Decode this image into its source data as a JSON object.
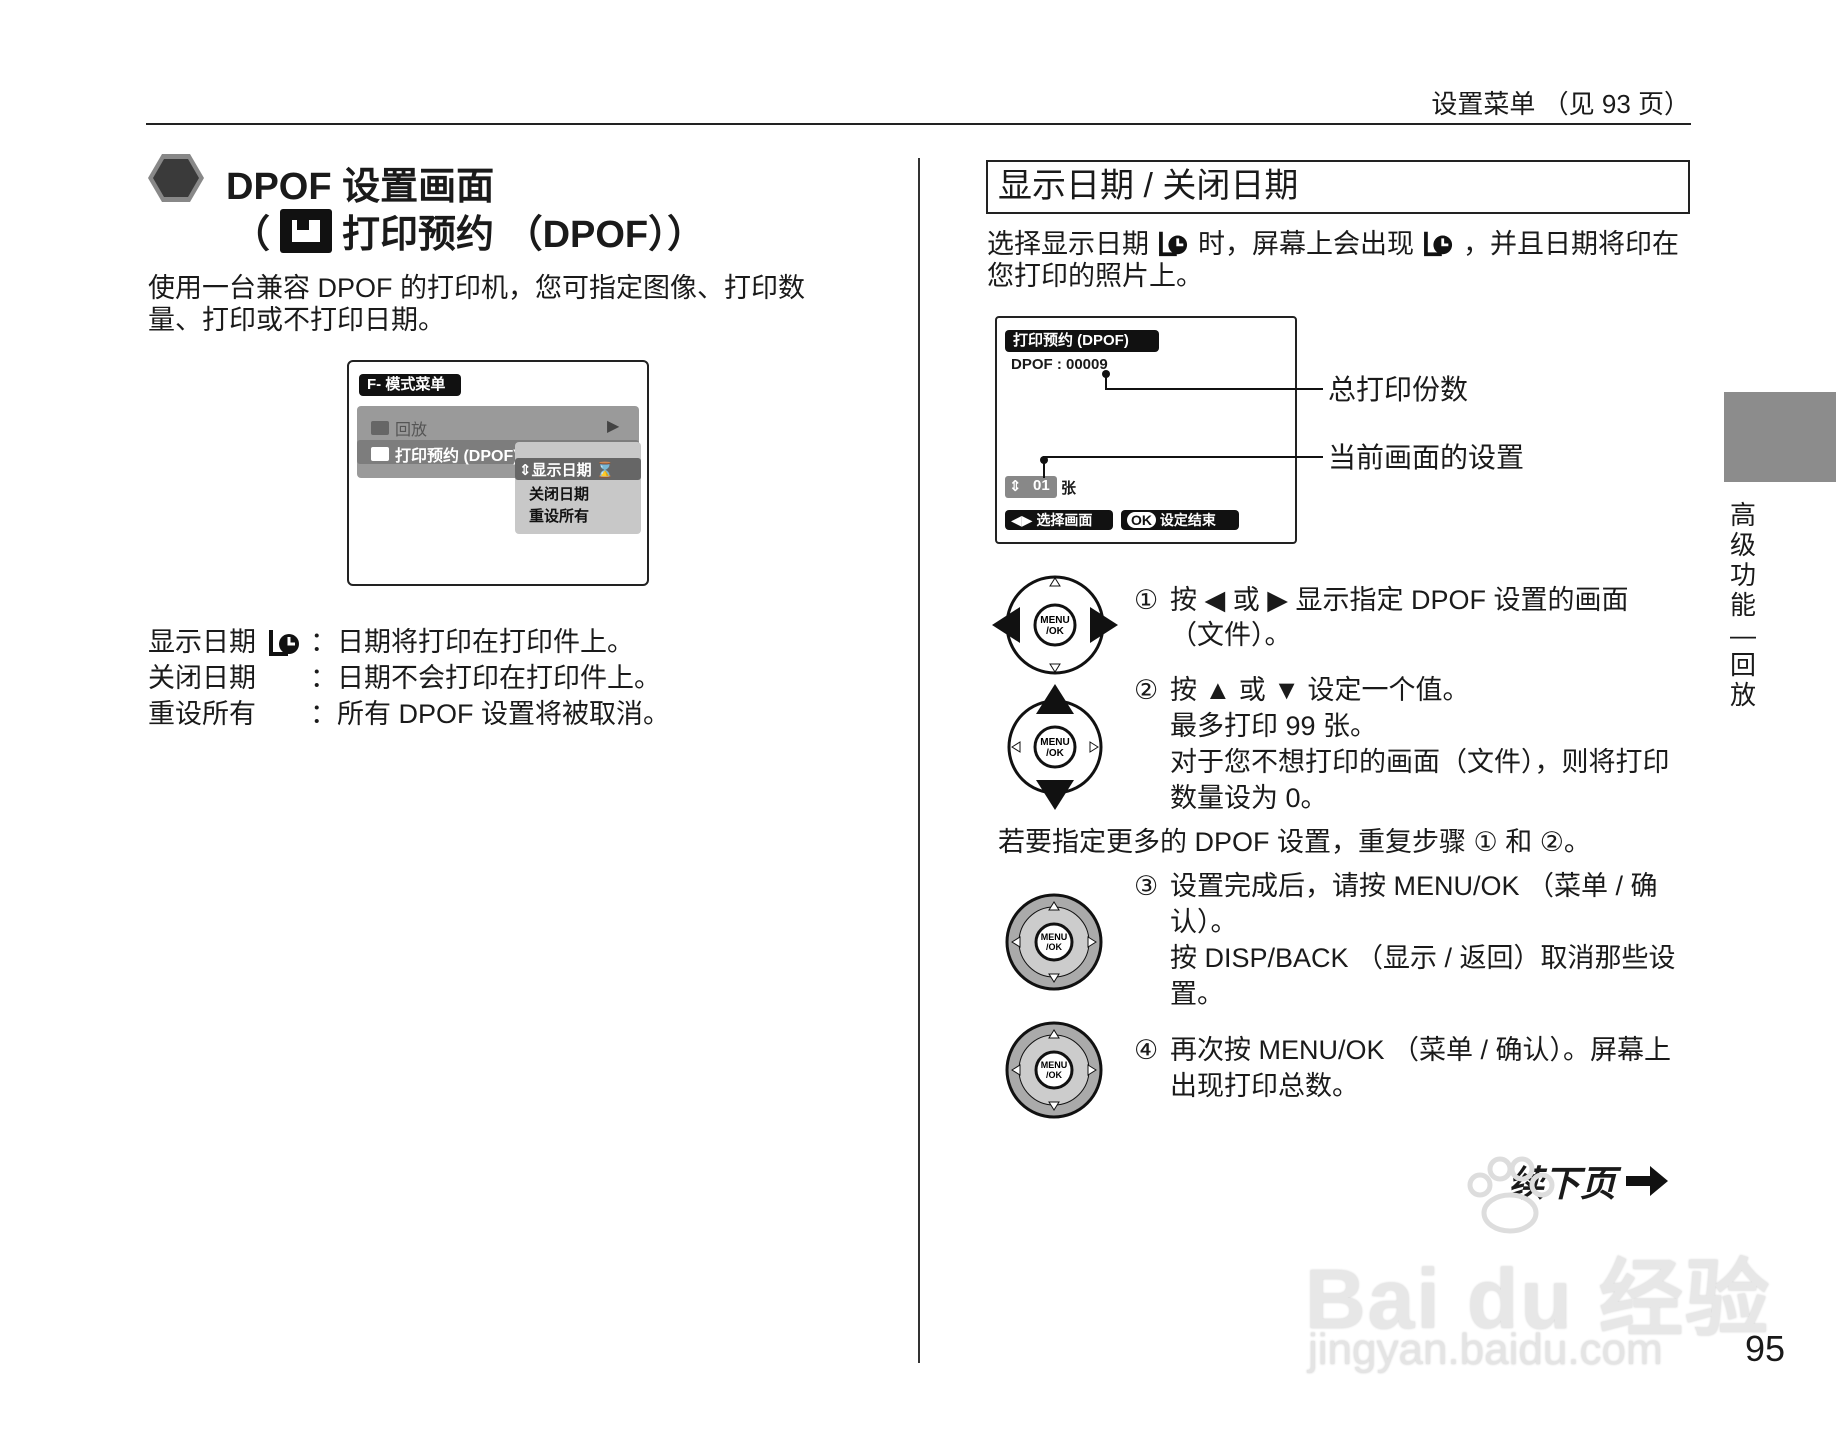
{
  "header": {
    "text": "设置菜单 （见 93 页）"
  },
  "left": {
    "title_line1": "DPOF 设置画面",
    "title_line2_prefix": "（",
    "title_line2_text": "打印预约 （DPOF））",
    "intro_line1": "使用一台兼容 DPOF 的打印机，您可指定图像、打印数",
    "intro_line2": "量、打印或不打印日期。",
    "screen": {
      "menu_title": "F- 模式菜单",
      "item_playback": "回放",
      "item_print": "打印预约 (DPOF)",
      "opt_date_on": "显示日期",
      "opt_date_off": "关闭日期",
      "opt_reset": "重设所有"
    },
    "options": [
      {
        "label": "显示日期",
        "desc": "：日期将打印在打印件上。"
      },
      {
        "label": "关闭日期",
        "desc": "：日期不会打印在打印件上。"
      },
      {
        "label": "重设所有",
        "desc": "：所有 DPOF 设置将被取消。"
      }
    ]
  },
  "right": {
    "heading": "显示日期 / 关闭日期",
    "intro_line1_a": "选择显示日期",
    "intro_line1_b": "时，屏幕上会出现",
    "intro_line1_c": "，并且日期将印在",
    "intro_line2": "您打印的照片上。",
    "screen": {
      "title": "打印预约 (DPOF)",
      "dpof_count": "DPOF : 00009",
      "current": "01",
      "unit": "张",
      "btn_select": "选择画面",
      "btn_ok_label": "OK",
      "btn_done": "设定结束"
    },
    "callout_total": "总打印份数",
    "callout_current": "当前画面的设置",
    "step1_line1": "按 ◀ 或 ▶ 显示指定 DPOF 设置的画面",
    "step1_line2": "（文件）。",
    "step2_line1": "按 ▲ 或 ▼ 设定一个值。",
    "step2_line2": "最多打印 99 张。",
    "step2_line3": "对于您不想打印的画面（文件），则将打印",
    "step2_line4": "数量设为 0。",
    "repeat": "若要指定更多的 DPOF 设置，重复步骤 ① 和 ②。",
    "step3_line1": "设置完成后，请按 MENU/OK （菜单 / 确",
    "step3_line2": "认）。",
    "step3_line3": "按 DISP/BACK （显示 / 返回）取消那些设",
    "step3_line4": "置。",
    "step4_line1": "再次按 MENU/OK （菜单 / 确认）。屏幕上",
    "step4_line2": "出现打印总数。",
    "step_nums": [
      "①",
      "②",
      "③",
      "④"
    ],
    "pad_label": "MENU\n/OK",
    "continue": "续下页"
  },
  "sidebar": {
    "label": "高级功能—回放"
  },
  "page_number": "95",
  "watermark": {
    "big": "Bai du 经验",
    "small": "jingyan.baidu.com"
  }
}
